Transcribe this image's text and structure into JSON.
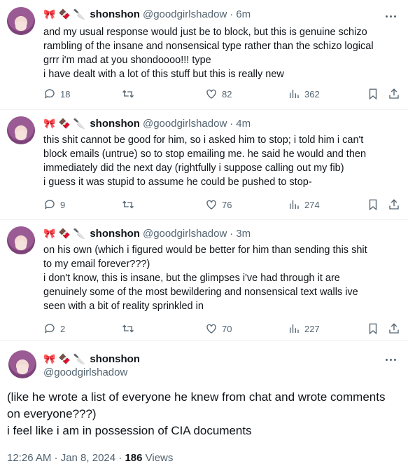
{
  "colors": {
    "text": "#0f1419",
    "muted": "#536471",
    "divider": "#eff3f4"
  },
  "replies": [
    {
      "name": "shonshon",
      "handle": "@goodgirlshadow",
      "time": "6m",
      "lines": [
        "and my usual response would just be to block, but this is genuine schizo",
        "rambling of the insane and nonsensical type rather than the schizo logical",
        "grrr i'm mad at you shondoooo!!! type",
        "i have dealt with a lot of this stuff but this is really new"
      ],
      "replies_count": "18",
      "likes": "82",
      "views": "362"
    },
    {
      "name": "shonshon",
      "handle": "@goodgirlshadow",
      "time": "4m",
      "lines": [
        "this shit cannot be good for him, so i asked him to stop; i told him i can't",
        "block emails (untrue) so to stop emailing me. he said he would and then",
        "immediately did the next day (rightfully i suppose calling out my fib)",
        "i guess it was stupid to assume he could be pushed to stop-"
      ],
      "replies_count": "9",
      "likes": "76",
      "views": "274"
    },
    {
      "name": "shonshon",
      "handle": "@goodgirlshadow",
      "time": "3m",
      "lines": [
        "on his own (which i figured would be better for him than sending this shit",
        "to my email forever???)",
        "i don't know, this is insane, but the glimpses i've had through it are",
        "genuinely some of the most bewildering and nonsensical text walls ive",
        "seen with a bit of reality sprinkled in"
      ],
      "replies_count": "2",
      "likes": "70",
      "views": "227"
    }
  ],
  "main_tweet": {
    "name": "shonshon",
    "handle": "@goodgirlshadow",
    "lines": [
      "(like he wrote a list of everyone he knew from chat and wrote comments",
      "on everyone???)",
      "i feel like i am in possession of CIA documents"
    ],
    "timestamp": "12:26 AM · Jan 8, 2024 · ",
    "views_count": "186",
    "views_label": " Views"
  },
  "icons": {
    "name_emojis": [
      "bow-emoji",
      "chocolate-emoji",
      "knife-emoji"
    ],
    "actions": [
      "reply-icon",
      "retweet-icon",
      "like-icon",
      "views-icon",
      "bookmark-icon",
      "share-icon"
    ]
  }
}
